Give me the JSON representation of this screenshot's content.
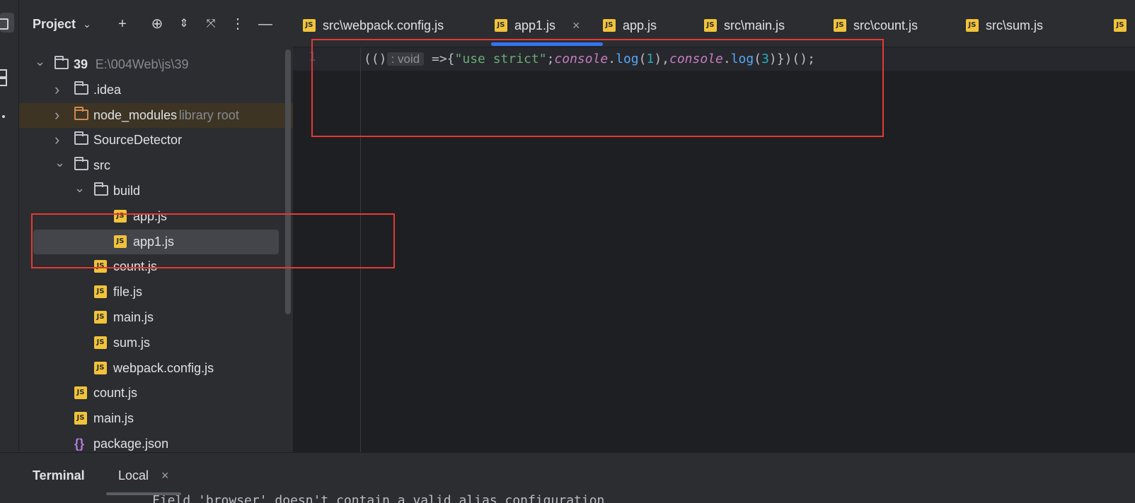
{
  "project_panel": {
    "title": "Project",
    "tree": [
      {
        "label": "39",
        "hint": "E:\\004Web\\js\\39",
        "depth": 0,
        "type": "folder",
        "expanded": true
      },
      {
        "label": ".idea",
        "depth": 1,
        "type": "folder",
        "expanded": false
      },
      {
        "label": "node_modules",
        "hint": "library root",
        "depth": 1,
        "type": "folder-lib",
        "expanded": false
      },
      {
        "label": "SourceDetector",
        "depth": 1,
        "type": "folder",
        "expanded": false
      },
      {
        "label": "src",
        "depth": 1,
        "type": "folder",
        "expanded": true
      },
      {
        "label": "build",
        "depth": 2,
        "type": "folder",
        "expanded": true
      },
      {
        "label": "app.js",
        "depth": 3,
        "type": "js"
      },
      {
        "label": "app1.js",
        "depth": 3,
        "type": "js",
        "selected": true
      },
      {
        "label": "count.js",
        "depth": 2,
        "type": "js"
      },
      {
        "label": "file.js",
        "depth": 2,
        "type": "js"
      },
      {
        "label": "main.js",
        "depth": 2,
        "type": "js"
      },
      {
        "label": "sum.js",
        "depth": 2,
        "type": "js"
      },
      {
        "label": "webpack.config.js",
        "depth": 2,
        "type": "js"
      },
      {
        "label": "count.js",
        "depth": 1,
        "type": "js"
      },
      {
        "label": "main.js",
        "depth": 1,
        "type": "js"
      },
      {
        "label": "package.json",
        "depth": 1,
        "type": "json"
      }
    ]
  },
  "editor_tabs": [
    {
      "label": "src\\webpack.config.js"
    },
    {
      "label": "app1.js",
      "active": true,
      "close": "×"
    },
    {
      "label": "app.js"
    },
    {
      "label": "src\\main.js"
    },
    {
      "label": "src\\count.js"
    },
    {
      "label": "src\\sum.js"
    }
  ],
  "editor": {
    "line_number": "1",
    "code": {
      "t1": "(()",
      "inlay": ": void",
      "t2": " =>{",
      "str": "\"use strict\"",
      "t3": ";",
      "obj1": "console",
      "t4": ".",
      "fn1": "log",
      "t5": "(",
      "num1": "1",
      "t6": "),",
      "obj2": "console",
      "t7": ".",
      "fn2": "log",
      "t8": "(",
      "num2": "3",
      "t9": ")})();"
    }
  },
  "terminal": {
    "title": "Terminal",
    "tab": "Local",
    "close": "×",
    "output": "Field 'browser' doesn't contain a valid alias configuration"
  },
  "icons": {
    "js_badge": "JS",
    "json_badge": "{}"
  },
  "colors": {
    "highlight_box": "#e53935",
    "tab_active_underline": "#3574f0",
    "js_icon": "#f1c33a"
  }
}
